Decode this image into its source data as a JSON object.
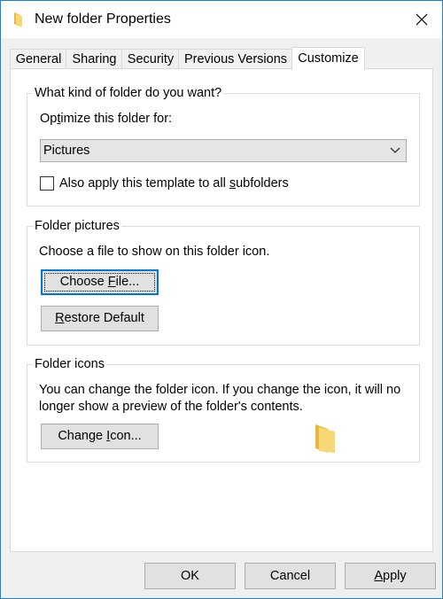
{
  "window": {
    "title": "New folder Properties",
    "icons": {
      "title": "folder-icon",
      "close": "close-icon"
    }
  },
  "tabs": [
    {
      "label": "General"
    },
    {
      "label": "Sharing"
    },
    {
      "label": "Security"
    },
    {
      "label": "Previous Versions"
    },
    {
      "label": "Customize",
      "active": true
    }
  ],
  "folder_type": {
    "title": "What kind of folder do you want?",
    "optimize_label_pre": "Op",
    "optimize_label_key": "t",
    "optimize_label_post": "imize this folder for:",
    "select_value": "Pictures",
    "checkbox_label_pre": "Also apply this template to all ",
    "checkbox_label_key": "s",
    "checkbox_label_post": "ubfolders",
    "checkbox_checked": false
  },
  "folder_pictures": {
    "title": "Folder pictures",
    "description": "Choose a file to show on this folder icon.",
    "choose_pre": "Choose ",
    "choose_key": "F",
    "choose_post": "ile...",
    "restore_key": "R",
    "restore_post": "estore Default"
  },
  "folder_icons": {
    "title": "Folder icons",
    "description_line1": "You can change the folder icon. If you change the icon, it will no",
    "description_line2": "longer show a preview of the folder's contents.",
    "change_pre": "Change ",
    "change_key": "I",
    "change_post": "con...",
    "preview_icon": "folder-icon"
  },
  "footer": {
    "ok": "OK",
    "cancel": "Cancel",
    "apply_key": "A",
    "apply_post": "pply"
  },
  "colors": {
    "accent": "#0078d7",
    "window_border": "#1883d7",
    "folder_yellow": "#f8d775"
  }
}
